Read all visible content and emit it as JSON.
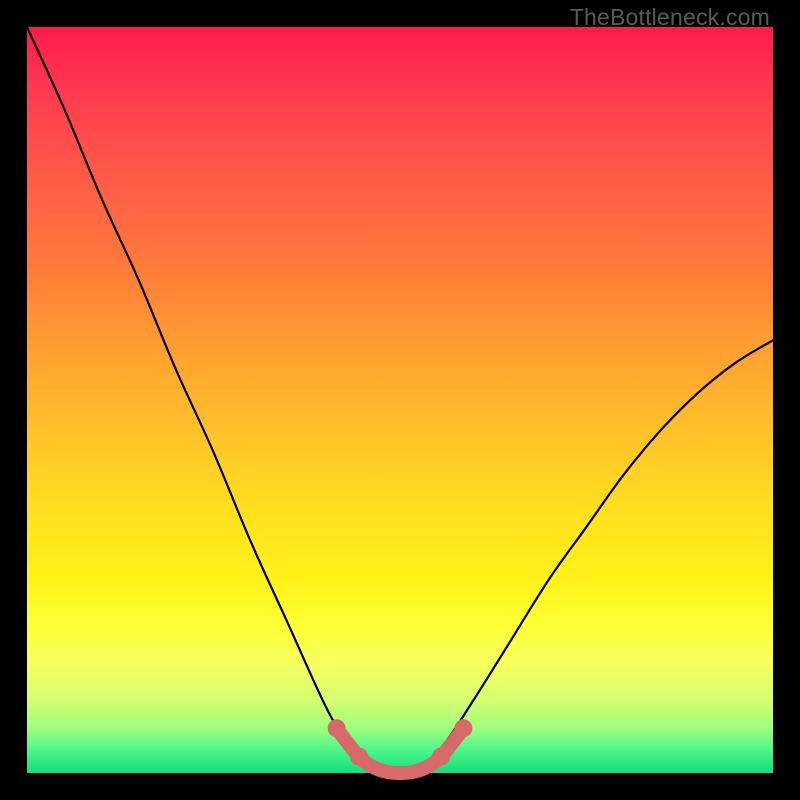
{
  "watermark": "TheBottleneck.com",
  "chart_data": {
    "type": "line",
    "title": "",
    "xlabel": "",
    "ylabel": "",
    "xlim": [
      0,
      1
    ],
    "ylim": [
      0,
      1
    ],
    "series": [
      {
        "name": "curve",
        "color_hex": "#000000",
        "x": [
          0.0,
          0.05,
          0.1,
          0.15,
          0.2,
          0.25,
          0.3,
          0.35,
          0.4,
          0.43,
          0.46,
          0.5,
          0.53,
          0.56,
          0.6,
          0.65,
          0.7,
          0.75,
          0.8,
          0.85,
          0.9,
          0.95,
          1.0
        ],
        "y": [
          1.0,
          0.89,
          0.77,
          0.66,
          0.54,
          0.43,
          0.31,
          0.2,
          0.09,
          0.04,
          0.01,
          0.0,
          0.01,
          0.04,
          0.1,
          0.18,
          0.26,
          0.33,
          0.4,
          0.46,
          0.51,
          0.55,
          0.58
        ]
      },
      {
        "name": "highlight",
        "color_hex": "#d66a6a",
        "x": [
          0.415,
          0.43,
          0.445,
          0.46,
          0.48,
          0.5,
          0.52,
          0.54,
          0.555,
          0.57,
          0.585
        ],
        "y": [
          0.06,
          0.04,
          0.022,
          0.01,
          0.002,
          0.0,
          0.002,
          0.01,
          0.022,
          0.04,
          0.06
        ]
      }
    ]
  },
  "colors": {
    "background": "#000000",
    "gradient_top": "#ff1a4d",
    "gradient_bottom": "#11e07a",
    "watermark": "#5a5a5a"
  }
}
